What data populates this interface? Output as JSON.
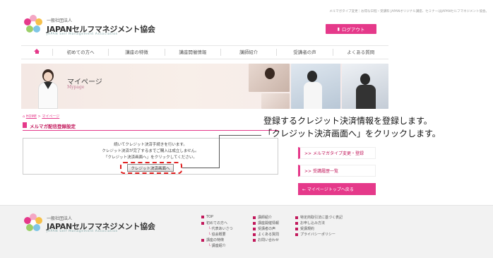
{
  "header": {
    "top_note": "メルマガタイプ変更｜お得な日程・受講料 JAPANオリジナル講座、セミナーはJAPANセルフマネジメント協会。",
    "org_small": "一般社団法人",
    "org_name": "JAPANセルフマネジメント協会",
    "org_en": "JAPAN Self Management Association",
    "logout_label": "ログアウト"
  },
  "nav": {
    "items": [
      {
        "icon": "home-icon"
      },
      {
        "label": "初めての方へ"
      },
      {
        "label": "講座の特徴"
      },
      {
        "label": "講座開催情報"
      },
      {
        "label": "講師紹介"
      },
      {
        "label": "受講者の声"
      },
      {
        "label": "よくある質問"
      }
    ]
  },
  "banner": {
    "title": "マイページ",
    "subtitle": "Mypage"
  },
  "breadcrumb": {
    "home": "HOME",
    "current": "マイページ"
  },
  "section": {
    "title": "メルマガ配信登録設定"
  },
  "panel": {
    "line1": "続いてクレジット決済手続きを行います。",
    "line2": "クレジット決済が完了するまでご購入は成立しません。",
    "line3": "「クレジット決済画面へ」をクリックしてください。",
    "button_label": "クレジット決済画面へ"
  },
  "annotation": {
    "line1": "登録するクレジット決済情報を登録します。",
    "line2": "「クレジット決済画面へ」をクリックします。"
  },
  "sidebar": {
    "btn1": ">>  メルマガタイプ変更・登録",
    "btn2": ">>  受講履歴一覧",
    "btn3": "←  マイページトップへ戻る"
  },
  "footer": {
    "org_small": "一般社団法人",
    "org_name": "JAPANセルフマネジメント協会",
    "org_en": "JAPAN Self Management Association",
    "col1": [
      "TOP",
      "初めての方へ",
      "代表あいさつ",
      "協会概要",
      "講座の特徴",
      "講座紹介"
    ],
    "col2": [
      "講師紹介",
      "講座開催情報",
      "受講者の声",
      "よくある質問",
      "お問い合わせ"
    ],
    "col3": [
      "特定商取引法に基づく表記",
      "お申し込み方法",
      "受講規約",
      "プライバシーポリシー"
    ]
  },
  "colors": {
    "accent": "#e5398a",
    "accent_dark": "#c2185b",
    "highlight": "#e02020"
  }
}
